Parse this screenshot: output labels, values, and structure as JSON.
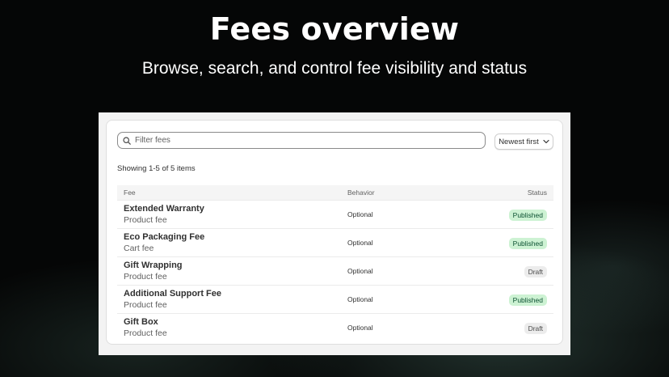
{
  "hero": {
    "title": "Fees overview",
    "subtitle": "Browse, search, and control fee visibility and status"
  },
  "toolbar": {
    "search_placeholder": "Filter fees",
    "search_icon": "search-icon",
    "sort_label": "Newest first",
    "sort_icon": "chevron-down-icon"
  },
  "summary": {
    "count_text": "Showing 1-5 of 5 items"
  },
  "table": {
    "columns": {
      "fee": "Fee",
      "behavior": "Behavior",
      "status": "Status"
    },
    "rows": [
      {
        "name": "Extended Warranty",
        "type": "Product fee",
        "behavior": "Optional",
        "status": "Published"
      },
      {
        "name": "Eco Packaging Fee",
        "type": "Cart fee",
        "behavior": "Optional",
        "status": "Published"
      },
      {
        "name": "Gift Wrapping",
        "type": "Product fee",
        "behavior": "Optional",
        "status": "Draft"
      },
      {
        "name": "Additional Support Fee",
        "type": "Product fee",
        "behavior": "Optional",
        "status": "Published"
      },
      {
        "name": "Gift Box",
        "type": "Product fee",
        "behavior": "Optional",
        "status": "Draft"
      }
    ]
  },
  "colors": {
    "published_bg": "#cdf2d3",
    "published_text": "#0c5132",
    "draft_bg": "#ececec",
    "draft_text": "#4a4a4a"
  }
}
